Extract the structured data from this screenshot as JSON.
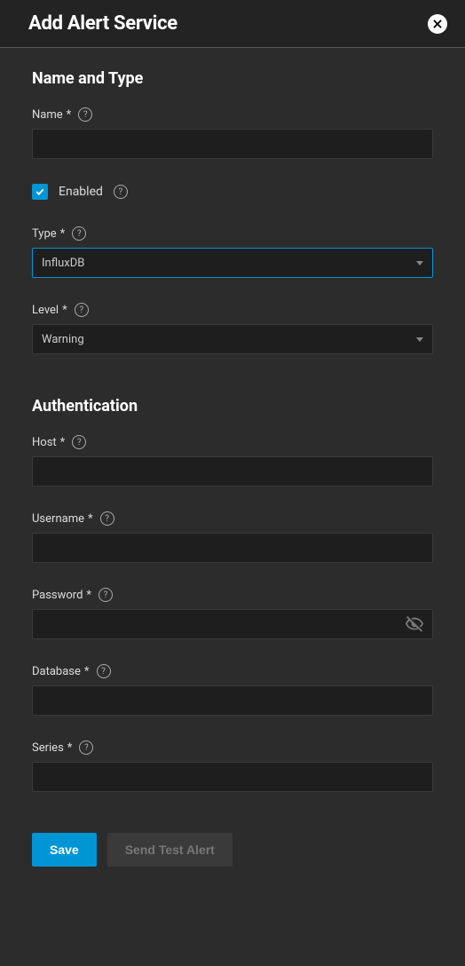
{
  "header": {
    "title": "Add Alert Service"
  },
  "sections": {
    "name_and_type": {
      "title": "Name and Type",
      "name_label": "Name",
      "name_value": "",
      "enabled_label": "Enabled",
      "enabled_checked": true,
      "type_label": "Type",
      "type_value": "InfluxDB",
      "level_label": "Level",
      "level_value": "Warning"
    },
    "authentication": {
      "title": "Authentication",
      "host_label": "Host",
      "host_value": "",
      "username_label": "Username",
      "username_value": "",
      "password_label": "Password",
      "password_value": "",
      "database_label": "Database",
      "database_value": "",
      "series_label": "Series",
      "series_value": ""
    }
  },
  "required_marker": "*",
  "footer": {
    "save_label": "Save",
    "send_test_label": "Send Test Alert"
  }
}
